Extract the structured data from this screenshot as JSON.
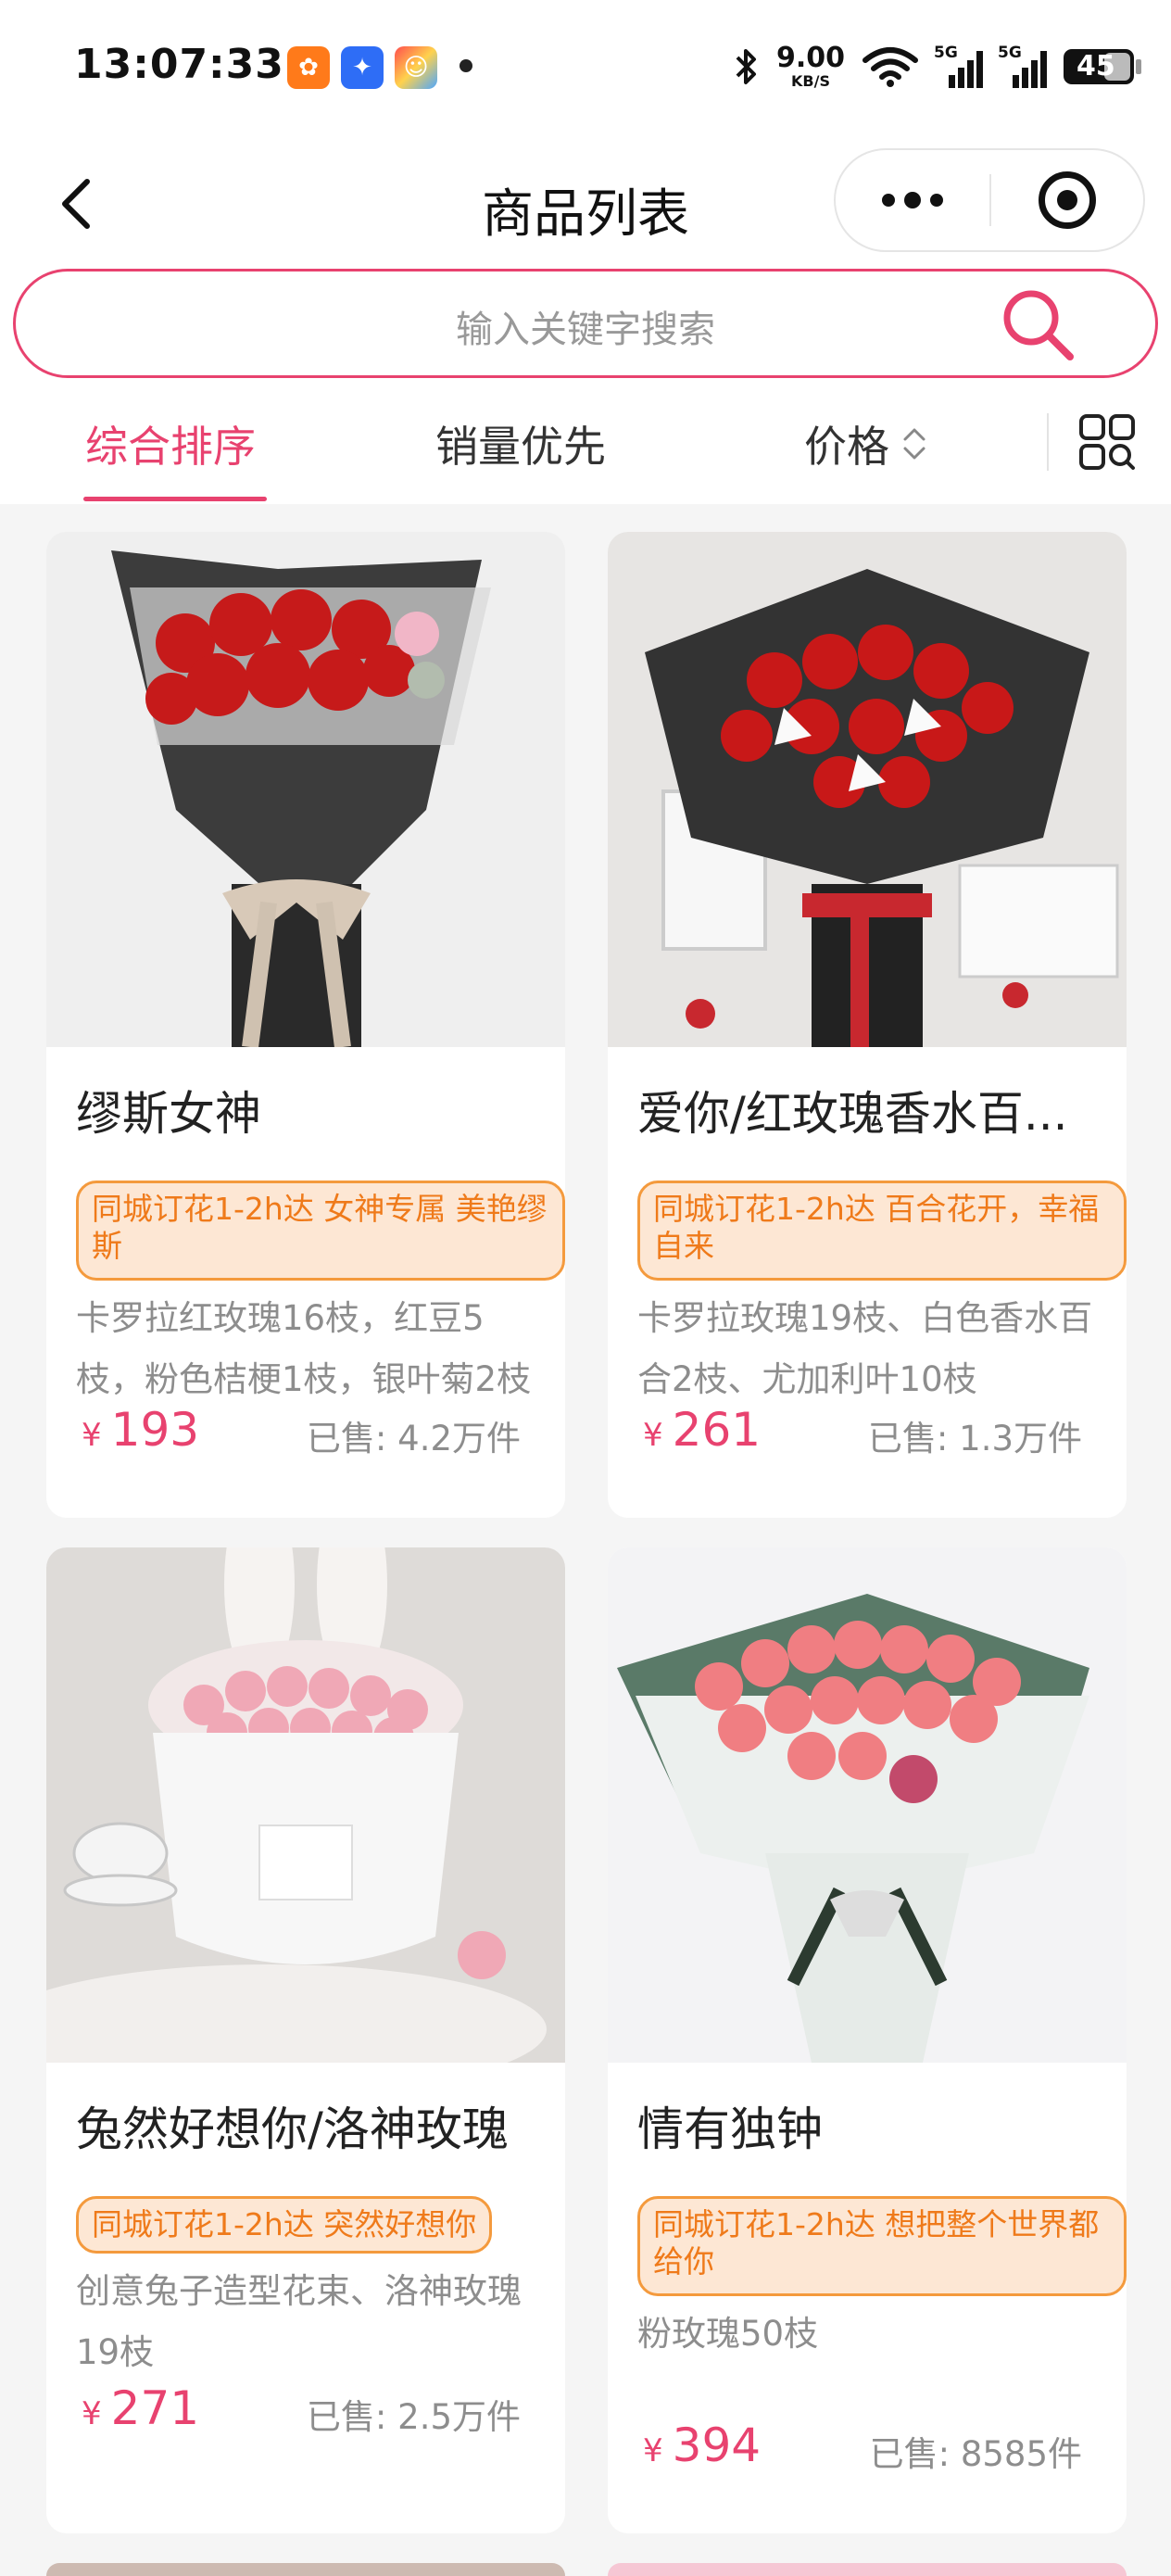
{
  "status_bar": {
    "time": "13:07:33",
    "net_speed_value": "9.00",
    "net_speed_unit": "KB/S",
    "signal_1": "5G",
    "signal_2": "5G",
    "battery": "45"
  },
  "nav": {
    "title": "商品列表"
  },
  "search": {
    "placeholder": "输入关键字搜索"
  },
  "sort": {
    "tabs": [
      "综合排序",
      "销量优先",
      "价格"
    ],
    "active_index": 0
  },
  "products": [
    {
      "name": "缪斯女神",
      "tag": "同城订花1-2h达 女神专属 美艳缪斯",
      "desc": "卡罗拉红玫瑰16枝，红豆5枝，粉色桔梗1枝，银叶菊2枝",
      "currency": "¥",
      "price": "193",
      "sold": "已售: 4.2万件"
    },
    {
      "name": "爱你/红玫瑰香水百...",
      "tag": "同城订花1-2h达 百合花开，幸福自来",
      "desc": "卡罗拉玫瑰19枝、白色香水百合2枝、尤加利叶10枝",
      "currency": "¥",
      "price": "261",
      "sold": "已售: 1.3万件"
    },
    {
      "name": "兔然好想你/洛神玫瑰",
      "tag": "同城订花1-2h达 突然好想你",
      "desc": "创意兔子造型花束、洛神玫瑰19枝",
      "currency": "¥",
      "price": "271",
      "sold": "已售: 2.5万件"
    },
    {
      "name": "情有独钟",
      "tag": "同城订花1-2h达 想把整个世界都给你",
      "desc": "粉玫瑰50枝",
      "currency": "¥",
      "price": "394",
      "sold": "已售: 8585件"
    }
  ],
  "colors": {
    "accent": "#e8426f",
    "tag_text": "#ef7a1a",
    "tag_bg": "#fde7d4",
    "tag_border": "#f49a3d"
  },
  "icons": {
    "back": "chevron-left-icon",
    "more": "more-dots-icon",
    "close": "target-circle-icon",
    "search": "search-icon",
    "price_sort": "up-down-chevron-icon",
    "layout": "grid-layout-icon"
  }
}
